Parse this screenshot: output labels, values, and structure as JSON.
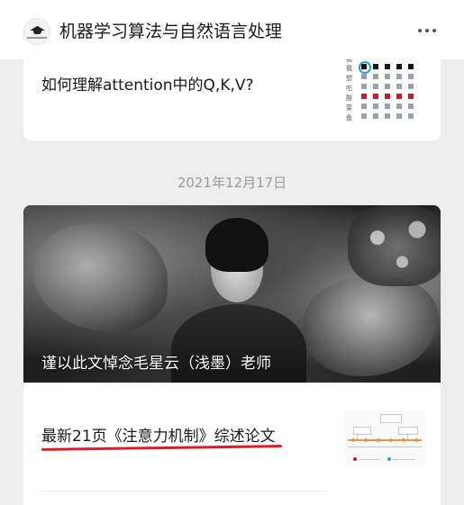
{
  "header": {
    "account_name": "机器学习算法与自然语言处理",
    "avatar_icon": "graduation-cap-icon",
    "more_icon": "more-dots-icon"
  },
  "articles": [
    {
      "title": "如何理解attention中的Q,K,V?",
      "thumbnail": {
        "row_labels": [
          "我",
          "想",
          "吃",
          "酸",
          "菜",
          "鱼"
        ],
        "colors": {
          "black": "#151515",
          "red": "#c0202a",
          "gray": "#9aa2aa",
          "highlight": "#2aa0d8"
        }
      }
    }
  ],
  "date_divider": "2021年12月17日",
  "feature": {
    "caption": "谨以此文悼念毛星云（浅墨）老师",
    "link_title": "最新21页《注意力机制》综述论文",
    "underline_color": "#d81e2a"
  }
}
